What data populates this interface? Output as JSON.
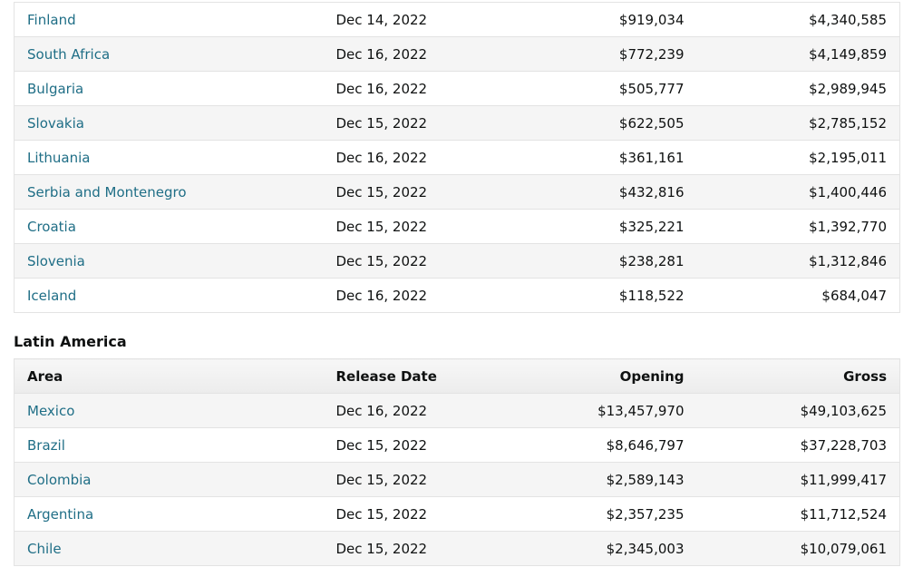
{
  "europe_table": {
    "rows": [
      {
        "area": "Finland",
        "release_date": "Dec 14, 2022",
        "opening": "$919,034",
        "gross": "$4,340,585"
      },
      {
        "area": "South Africa",
        "release_date": "Dec 16, 2022",
        "opening": "$772,239",
        "gross": "$4,149,859"
      },
      {
        "area": "Bulgaria",
        "release_date": "Dec 16, 2022",
        "opening": "$505,777",
        "gross": "$2,989,945"
      },
      {
        "area": "Slovakia",
        "release_date": "Dec 15, 2022",
        "opening": "$622,505",
        "gross": "$2,785,152"
      },
      {
        "area": "Lithuania",
        "release_date": "Dec 16, 2022",
        "opening": "$361,161",
        "gross": "$2,195,011"
      },
      {
        "area": "Serbia and Montenegro",
        "release_date": "Dec 15, 2022",
        "opening": "$432,816",
        "gross": "$1,400,446"
      },
      {
        "area": "Croatia",
        "release_date": "Dec 15, 2022",
        "opening": "$325,221",
        "gross": "$1,392,770"
      },
      {
        "area": "Slovenia",
        "release_date": "Dec 15, 2022",
        "opening": "$238,281",
        "gross": "$1,312,846"
      },
      {
        "area": "Iceland",
        "release_date": "Dec 16, 2022",
        "opening": "$118,522",
        "gross": "$684,047"
      }
    ]
  },
  "latam_section": {
    "title": "Latin America",
    "columns": {
      "area": "Area",
      "release_date": "Release Date",
      "opening": "Opening",
      "gross": "Gross"
    },
    "rows": [
      {
        "area": "Mexico",
        "release_date": "Dec 16, 2022",
        "opening": "$13,457,970",
        "gross": "$49,103,625"
      },
      {
        "area": "Brazil",
        "release_date": "Dec 15, 2022",
        "opening": "$8,646,797",
        "gross": "$37,228,703"
      },
      {
        "area": "Colombia",
        "release_date": "Dec 15, 2022",
        "opening": "$2,589,143",
        "gross": "$11,999,417"
      },
      {
        "area": "Argentina",
        "release_date": "Dec 15, 2022",
        "opening": "$2,357,235",
        "gross": "$11,712,524"
      },
      {
        "area": "Chile",
        "release_date": "Dec 15, 2022",
        "opening": "$2,345,003",
        "gross": "$10,079,061"
      }
    ]
  },
  "colors": {
    "link": "#1f6e86",
    "row_alt": "#f5f5f5",
    "border": "#e3e3e3"
  }
}
